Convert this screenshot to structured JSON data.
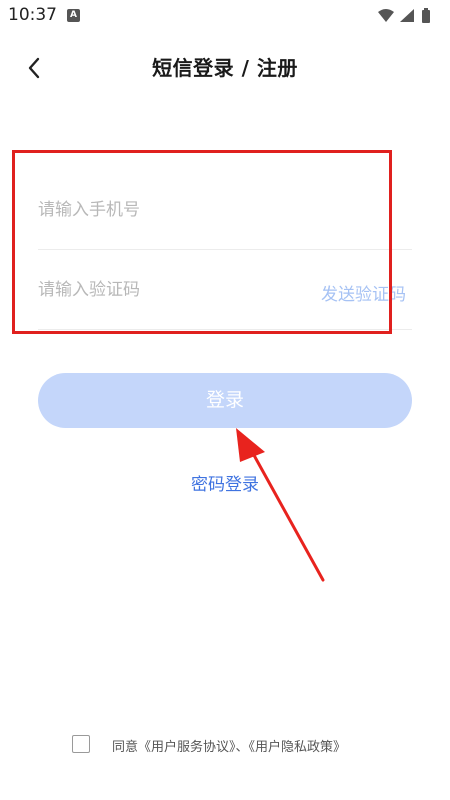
{
  "status_bar": {
    "time": "10:37",
    "notification_icon": "A"
  },
  "header": {
    "title": "短信登录 / 注册",
    "back_icon": "chevron-left-icon"
  },
  "form": {
    "phone_placeholder": "请输入手机号",
    "phone_value": "",
    "code_placeholder": "请输入验证码",
    "code_value": "",
    "send_code_label": "发送验证码"
  },
  "login_button_label": "登录",
  "password_login_label": "密码登录",
  "agreement": {
    "prefix": "同意",
    "user_agreement": "《用户服务协议》",
    "separator": "、",
    "privacy_policy": "《用户隐私政策》",
    "checked": false
  },
  "colors": {
    "accent": "#3f73e0",
    "button_disabled": "#c4d6fa",
    "annotation_red": "#e0201e"
  }
}
